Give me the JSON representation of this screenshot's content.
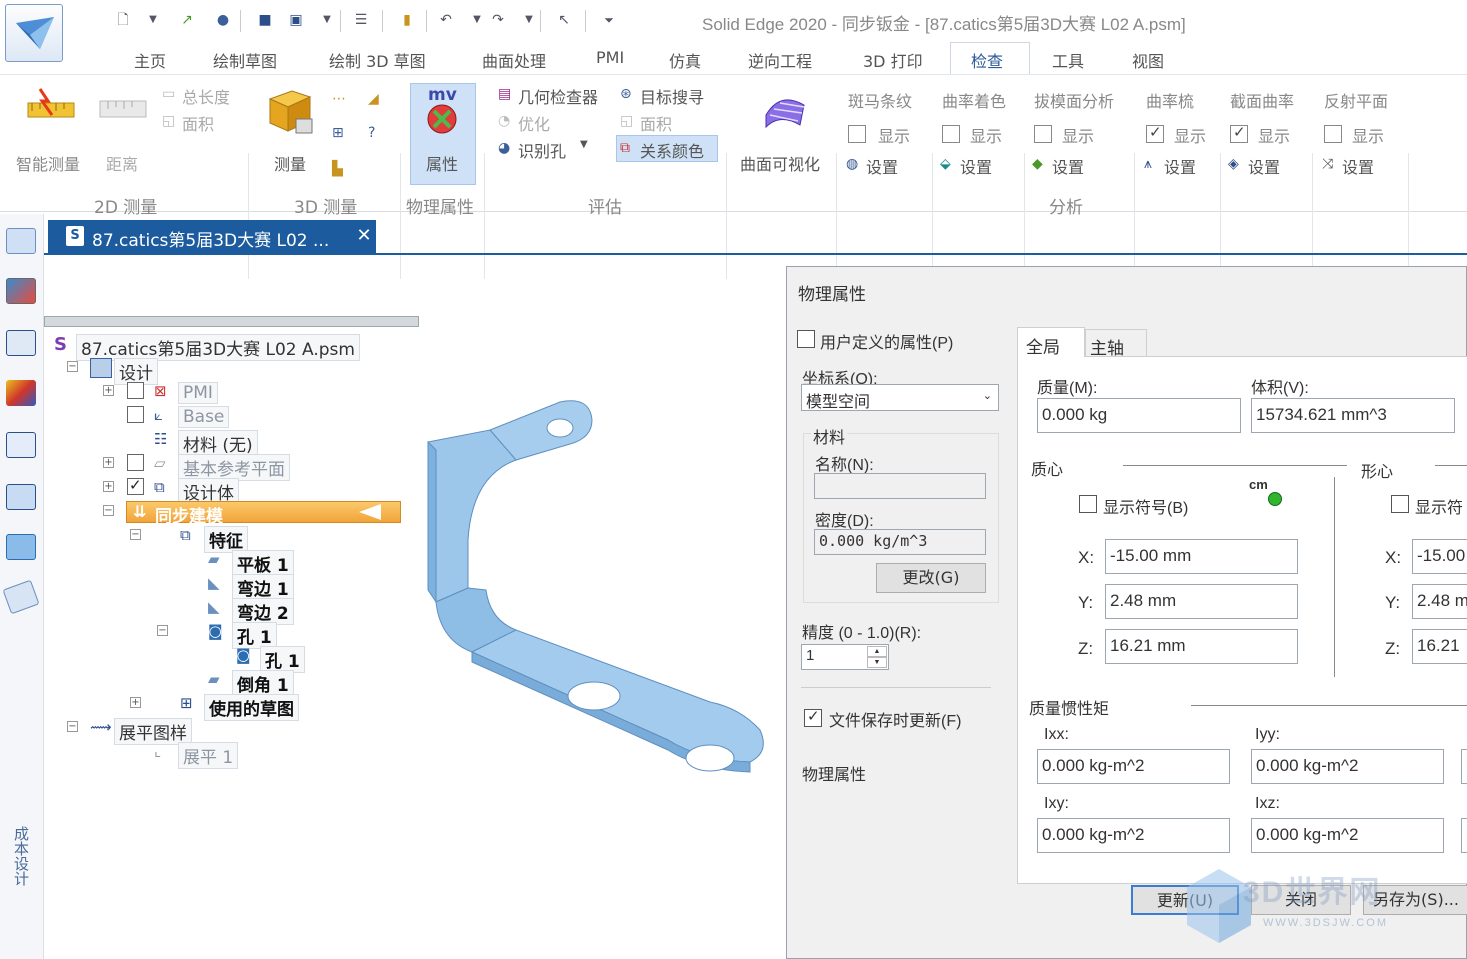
{
  "window": {
    "title": "Solid Edge 2020 - 同步钣金 - [87.catics第5届3D大赛 L02 A.psm]"
  },
  "menu": [
    "主页",
    "绘制草图",
    "绘制 3D 草图",
    "曲面处理",
    "PMI",
    "仿真",
    "逆向工程",
    "3D 打印",
    "检查",
    "工具",
    "视图"
  ],
  "ribbon": {
    "smart_measure": "智能测量",
    "distance": "距离",
    "total_length": "总长度",
    "area": "面积",
    "group_2d": "2D 测量",
    "measure": "测量",
    "group_3d": "3D 测量",
    "properties": "属性",
    "group_physical": "物理属性",
    "geometry_inspector": "几何检查器",
    "optimize": "优化",
    "identify_hole": "识别孔",
    "target_search": "目标搜寻",
    "area2": "面积",
    "relation_color": "关系颜色",
    "group_evaluate": "评估",
    "surface_visual": "曲面可视化",
    "zebra": "斑马条纹",
    "curvature_shade": "曲率着色",
    "draft_analysis": "拔模面分析",
    "curvature_comb": "曲率梳",
    "section_curvature": "截面曲率",
    "reflection_plane": "反射平面",
    "show": "显示",
    "settings": "设置",
    "group_analysis": "分析",
    "mv_badge": "mv"
  },
  "sidebar": {
    "cost_design": "成本设计"
  },
  "doc_tab": {
    "title": "87.catics第5届3D大赛 L02 ...",
    "close": "✕"
  },
  "tree": {
    "root": "87.catics第5届3D大赛 L02 A.psm",
    "design": "设计",
    "pmi": "PMI",
    "base": "Base",
    "material": "材料 (无)",
    "ref_planes": "基本参考平面",
    "design_body": "设计体",
    "sync_model": "同步建模",
    "features": "特征",
    "tab1": "平板 1",
    "flange1": "弯边 1",
    "flange2": "弯边 2",
    "hole1": "孔 1",
    "hole1_child": "孔 1",
    "chamfer1": "倒角 1",
    "used_sketches": "使用的草图",
    "flat_pattern": "展平图样",
    "flat1": "展平 1"
  },
  "dialog": {
    "title": "物理属性",
    "user_defined": "用户定义的属性(P)",
    "coord_label": "坐标系(O):",
    "coord_value": "模型空间",
    "material_group": "材料",
    "name_label": "名称(N):",
    "name_value": "",
    "density_label": "密度(D):",
    "density_value": "0.000 kg/m^3",
    "change_btn": "更改(G)",
    "accuracy_label": "精度 (0 - 1.0)(R):",
    "accuracy_value": "1",
    "update_on_save": "文件保存时更新(F)",
    "physical_props": "物理属性",
    "tab_global": "全局",
    "tab_principal": "主轴",
    "mass_label": "质量(M):",
    "mass_value": "0.000 kg",
    "volume_label": "体积(V):",
    "volume_value": "15734.621 mm^3",
    "center_mass": "质心",
    "centroid": "形心",
    "show_symbol": "显示符号(B)",
    "show_symbol2": "显示符",
    "cm_badge": "cm",
    "x_label": "X:",
    "y_label": "Y:",
    "z_label": "Z:",
    "cm_x": "-15.00 mm",
    "cm_y": "2.48 mm",
    "cm_z": "16.21 mm",
    "cent_x": "-15.00",
    "cent_y": "2.48 m",
    "cent_z": "16.21",
    "moi_label": "质量惯性矩",
    "ixx_label": "Ixx:",
    "iyy_label": "Iyy:",
    "ixy_label": "Ixy:",
    "ixz_label": "Ixz:",
    "ixx": "0.000 kg-m^2",
    "iyy": "0.000 kg-m^2",
    "ixy": "0.000 kg-m^2",
    "ixz": "0.000 kg-m^2",
    "update_btn": "更新(U)",
    "close_btn": "关闭",
    "saveas_btn": "另存为(S)..."
  },
  "watermark": {
    "text": "3D世界网",
    "url": "WWW.3DSJW.COM"
  },
  "colors": {
    "accent": "#1d5b9f",
    "part_blue": "#9cc7ea",
    "highlight_orange": "#f5b24a"
  }
}
